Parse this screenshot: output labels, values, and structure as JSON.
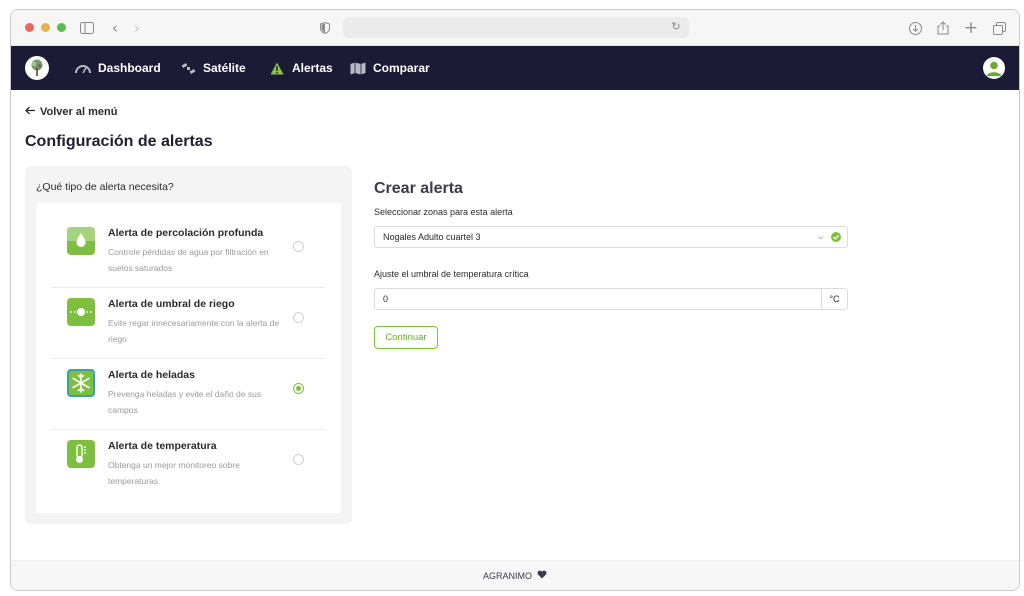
{
  "nav": {
    "items": [
      {
        "label": "Dashboard",
        "icon": "gauge-icon"
      },
      {
        "label": "Satélite",
        "icon": "satellite-icon"
      },
      {
        "label": "Alertas",
        "icon": "warning-icon"
      },
      {
        "label": "Comparar",
        "icon": "map-icon"
      }
    ]
  },
  "page": {
    "back_label": "Volver al menú",
    "title": "Configuración de alertas"
  },
  "left_panel": {
    "question": "¿Qué tipo de alerta necesita?",
    "options": [
      {
        "title": "Alerta de percolación profunda",
        "description": "Controle pérdidas de agua por filtración en suelos saturados",
        "icon": "water-drop-icon",
        "selected": false
      },
      {
        "title": "Alerta de umbral de riego",
        "description": "Evite regar innecesariamente con la alerta de riego",
        "icon": "irrigation-icon",
        "selected": false
      },
      {
        "title": "Alerta de heladas",
        "description": "Prevenga heladas y evite el daño de sus campos",
        "icon": "snowflake-icon",
        "selected": true
      },
      {
        "title": "Alerta de temperatura",
        "description": "Obtenga un mejor monitoreo sobre temperaturas",
        "icon": "thermometer-icon",
        "selected": false
      }
    ]
  },
  "form": {
    "title": "Crear alerta",
    "zones_label": "Seleccionar zonas para esta alerta",
    "zones_value": "Nogales Adulto cuartel 3",
    "threshold_label": "Ajuste el umbral de temperatura crítica",
    "threshold_value": "0",
    "threshold_unit": "°C",
    "continue_label": "Continuar"
  },
  "footer": {
    "brand": "AGRANIMO"
  },
  "colors": {
    "navbar": "#1c1b36",
    "accent_green": "#7fbf3f",
    "selected_border": "#3aa1a8"
  }
}
